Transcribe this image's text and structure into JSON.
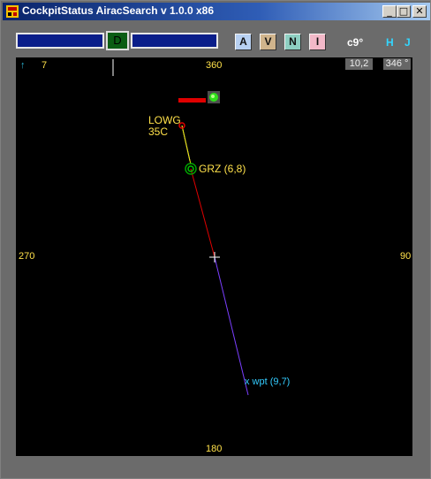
{
  "window": {
    "title": "CockpitStatus AiracSearch v 1.0.0  x86"
  },
  "titlebar": {
    "minimize": "_",
    "maximize": "□",
    "close": "✕"
  },
  "toolbar": {
    "d_button": "D",
    "mode_buttons": [
      {
        "label": "A",
        "color": "#b7d0f2"
      },
      {
        "label": "V",
        "color": "#d0b48c"
      },
      {
        "label": "N",
        "color": "#8ecfc2"
      },
      {
        "label": "I",
        "color": "#f2b8c8"
      }
    ],
    "temp": "c9°",
    "h": "H",
    "j": "J"
  },
  "map": {
    "north_arrow": "↑",
    "north_value": "7",
    "hdg_top": "360",
    "hdg_left": "270",
    "hdg_right": "90",
    "hdg_bottom": "180",
    "box_left": "10,2",
    "box_right": "346 °",
    "airport_code": "LOWG",
    "runway": "35C",
    "navaid": "GRZ (6,8)",
    "waypoint": "x wpt (9,7)"
  },
  "colors": {
    "map_bg": "#000000",
    "label_yellow": "#ffe14a",
    "route_red": "#e00000",
    "route_purple": "#7b3fff",
    "wpt_cyan": "#33ccff",
    "hj_cyan": "#33d6ff"
  }
}
